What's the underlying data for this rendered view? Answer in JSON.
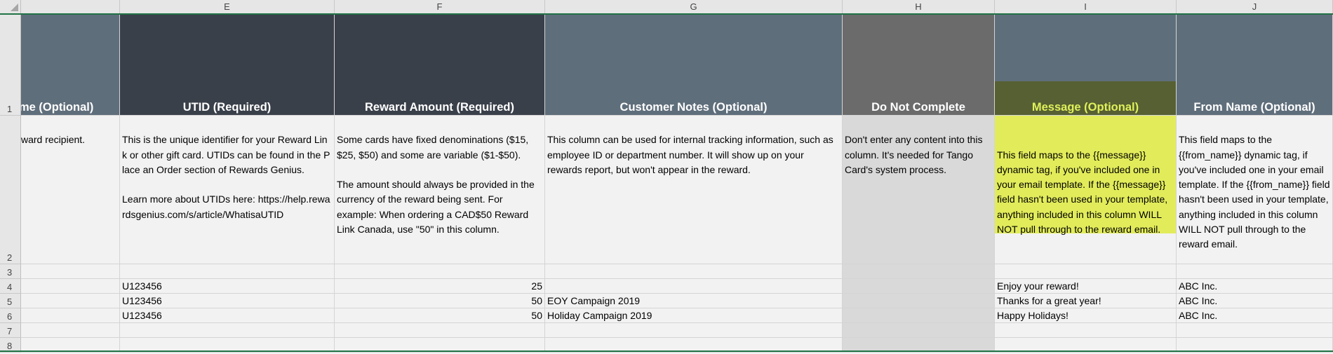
{
  "columns": [
    "E",
    "F",
    "G",
    "H",
    "I",
    "J"
  ],
  "rows": [
    "1",
    "2",
    "3",
    "4",
    "5",
    "6",
    "7",
    "8"
  ],
  "headers": {
    "d": "me (Optional)",
    "e": "UTID (Required)",
    "f": "Reward Amount (Required)",
    "g": "Customer Notes (Optional)",
    "h": "Do Not Complete",
    "i": "Message (Optional)",
    "j": "From Name (Optional)"
  },
  "descriptions": {
    "d": "ward recipient.",
    "e": "This is the unique identifier for your Reward Link or other gift card. UTIDs can be found in the Place an Order section of Rewards Genius.\n\nLearn more about UTIDs here: https://help.rewardsgenius.com/s/article/WhatisaUTID",
    "f": "Some cards have fixed denominations ($15, $25, $50) and some are variable ($1-$50).\n\nThe amount should always be provided in the currency of the reward being sent. For example: When ordering a CAD$50 Reward Link Canada, use \"50\" in this column.",
    "g": "This column can be used for internal tracking information, such as employee ID or department number. It will show up on your rewards report, but won't appear in the reward.",
    "h": "Don't enter any content into this column. It's needed for Tango Card's system process.",
    "i": "This field maps to the {{message}} dynamic tag, if you've included one in your email template. If the {{message}} field hasn't been used in your template, anything included in this column WILL NOT pull through to the reward email.",
    "j": "This field maps to the {{from_name}} dynamic tag, if you've included one in your email template. If the {{from_name}} field hasn't been used in your template, anything included in this column WILL NOT pull through to the reward email."
  },
  "data_rows": [
    {
      "utid": "U123456",
      "amount": "25",
      "notes": "",
      "message": "Enjoy your reward!",
      "from_name": "ABC Inc."
    },
    {
      "utid": "U123456",
      "amount": "50",
      "notes": "EOY Campaign 2019",
      "message": "Thanks for a great year!",
      "from_name": "ABC Inc."
    },
    {
      "utid": "U123456",
      "amount": "50",
      "notes": "Holiday Campaign 2019",
      "message": "Happy Holidays!",
      "from_name": "ABC Inc."
    }
  ],
  "colors": {
    "header_d": "#5f6e7b",
    "header_e": "#3a404a",
    "header_f": "#3a404a",
    "header_g": "#5f6e7b",
    "header_h": "#6b6b6b",
    "header_i_bg": "#5f6e7b",
    "header_i_highlight": "#566032",
    "header_i_text": "#dff05a",
    "header_j": "#5f6e7b",
    "desc_i_highlight": "#e2ec5a",
    "column_h_fill": "#d9d9d9",
    "grid_accent": "#217346"
  }
}
